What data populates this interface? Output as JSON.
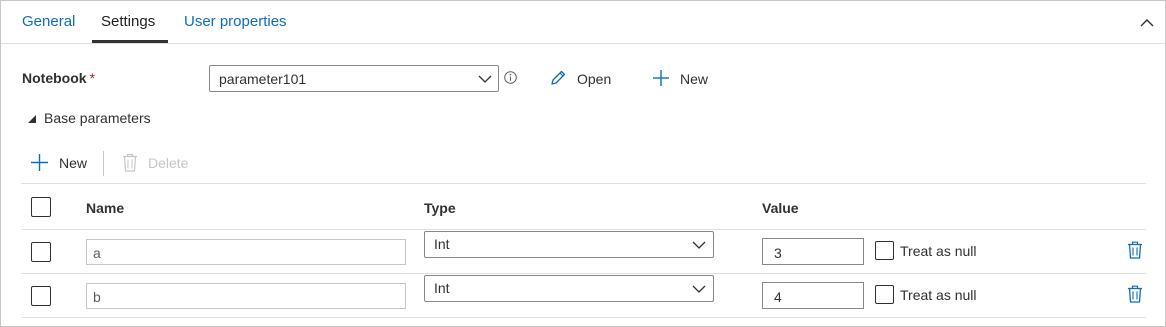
{
  "tabs": [
    {
      "label": "General",
      "active": false
    },
    {
      "label": "Settings",
      "active": true
    },
    {
      "label": "User properties",
      "active": false
    }
  ],
  "notebook": {
    "label": "Notebook",
    "required_mark": "*",
    "selected": "parameter101",
    "open_label": "Open",
    "new_label": "New"
  },
  "base_parameters": {
    "section_label": "Base parameters",
    "toolbar": {
      "new_label": "New",
      "delete_label": "Delete"
    },
    "columns": {
      "name": "Name",
      "type": "Type",
      "value": "Value"
    },
    "rows": [
      {
        "name": "a",
        "type": "Int",
        "value": "3",
        "null_label": "Treat as null"
      },
      {
        "name": "b",
        "type": "Int",
        "value": "4",
        "null_label": "Treat as null"
      }
    ]
  },
  "colors": {
    "accent": "#0f6cbd",
    "text": "#323130",
    "disabled": "#c8c6c4",
    "required": "#a4262c"
  },
  "icons": {
    "collapse": "chevron-up-icon",
    "dropdown": "chevron-down-icon",
    "info": "info-icon",
    "open": "pencil-icon",
    "new": "plus-icon",
    "delete": "trash-icon",
    "section": "triangle-expanded-icon"
  }
}
